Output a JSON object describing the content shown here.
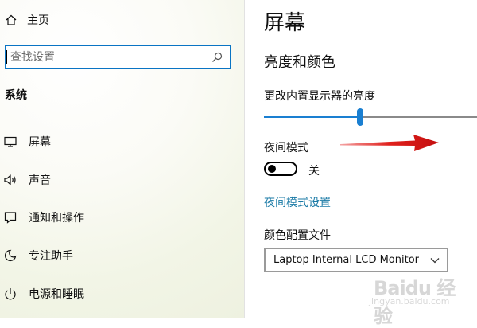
{
  "sidebar": {
    "home_label": "主页",
    "search_placeholder": "查找设置",
    "section_title": "系统",
    "items": [
      {
        "label": "屏幕",
        "icon": "monitor-icon"
      },
      {
        "label": "声音",
        "icon": "speaker-icon"
      },
      {
        "label": "通知和操作",
        "icon": "notification-icon"
      },
      {
        "label": "专注助手",
        "icon": "moon-icon"
      },
      {
        "label": "电源和睡眠",
        "icon": "power-icon"
      }
    ]
  },
  "main": {
    "title": "屏幕",
    "subsection_title": "亮度和颜色",
    "brightness": {
      "label": "更改内置显示器的亮度",
      "value_fraction": 0.45
    },
    "night_light": {
      "label": "夜间模式",
      "state": "关",
      "is_on": false,
      "settings_link": "夜间模式设置"
    },
    "color_profile": {
      "label": "颜色配置文件",
      "selected": "Laptop Internal LCD Monitor"
    }
  },
  "overlay": {
    "arrow_color": "#e0201c",
    "watermark_text": "Baidu 经验",
    "watermark_url": "jingyan.baidu.com"
  },
  "colors": {
    "accent": "#1a7fd1",
    "link": "#1a7aa6",
    "search_border": "#0a74c4"
  }
}
